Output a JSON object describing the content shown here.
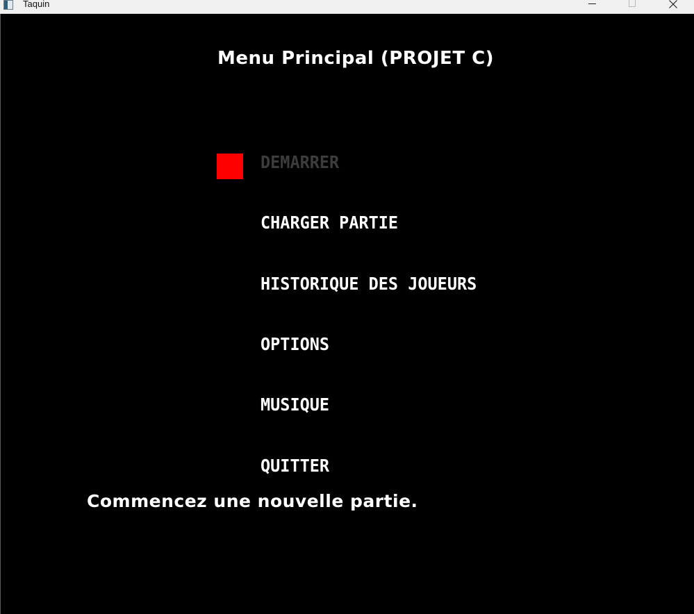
{
  "window": {
    "title": "Taquin",
    "icon": "app-window-icon",
    "controls": [
      "minimize-icon",
      "maximize-icon",
      "close-icon"
    ]
  },
  "menu": {
    "title": "Menu Principal (PROJET C)",
    "selected_index": 0,
    "items": [
      {
        "label": "DEMARRER"
      },
      {
        "label": "CHARGER PARTIE"
      },
      {
        "label": "HISTORIQUE DES JOUEURS"
      },
      {
        "label": "OPTIONS"
      },
      {
        "label": "MUSIQUE"
      },
      {
        "label": "QUITTER"
      }
    ],
    "description": "Commencez une nouvelle partie."
  },
  "colors": {
    "background": "#000000",
    "text": "#ffffff",
    "selected_text": "#3c3c3c",
    "cursor": "#ff0000"
  }
}
